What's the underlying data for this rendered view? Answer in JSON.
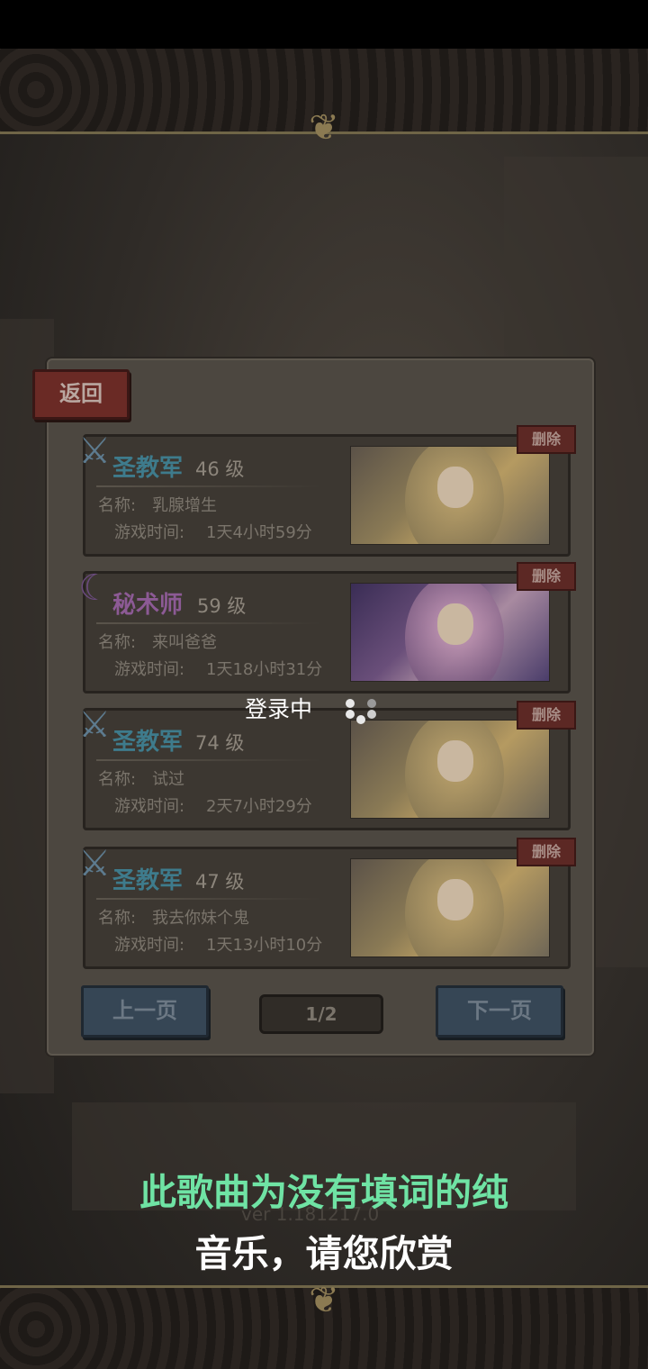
{
  "back_label": "返回",
  "delete_label": "删除",
  "name_prefix": "名称:",
  "time_prefix": "游戏时间:",
  "characters": [
    {
      "class": "圣教军",
      "level": "46 级",
      "name": "乳腺增生",
      "time": "1天4小时59分",
      "class_icon": "crossed-swords-icon"
    },
    {
      "class": "秘术师",
      "level": "59 级",
      "name": "来叫爸爸",
      "time": "1天18小时31分",
      "class_icon": "magic-crescent-icon"
    },
    {
      "class": "圣教军",
      "level": "74 级",
      "name": "试过",
      "time": "2天7小时29分",
      "class_icon": "crossed-swords-icon"
    },
    {
      "class": "圣教军",
      "level": "47 级",
      "name": "我去你妹个鬼",
      "time": "1天13小时10分",
      "class_icon": "crossed-swords-icon"
    }
  ],
  "prev_label": "上一页",
  "next_label": "下一页",
  "page_indicator": "1/2",
  "loading_text": "登录中",
  "version_text": "ver 1.181217.0",
  "subtitle_line1": "此歌曲为没有填词的纯",
  "subtitle_line2": "音乐，请您欣赏",
  "colors": {
    "subtitle_accent": "#6fe3a4",
    "delete_button": "#5c2824",
    "nav_button": "#364655"
  }
}
